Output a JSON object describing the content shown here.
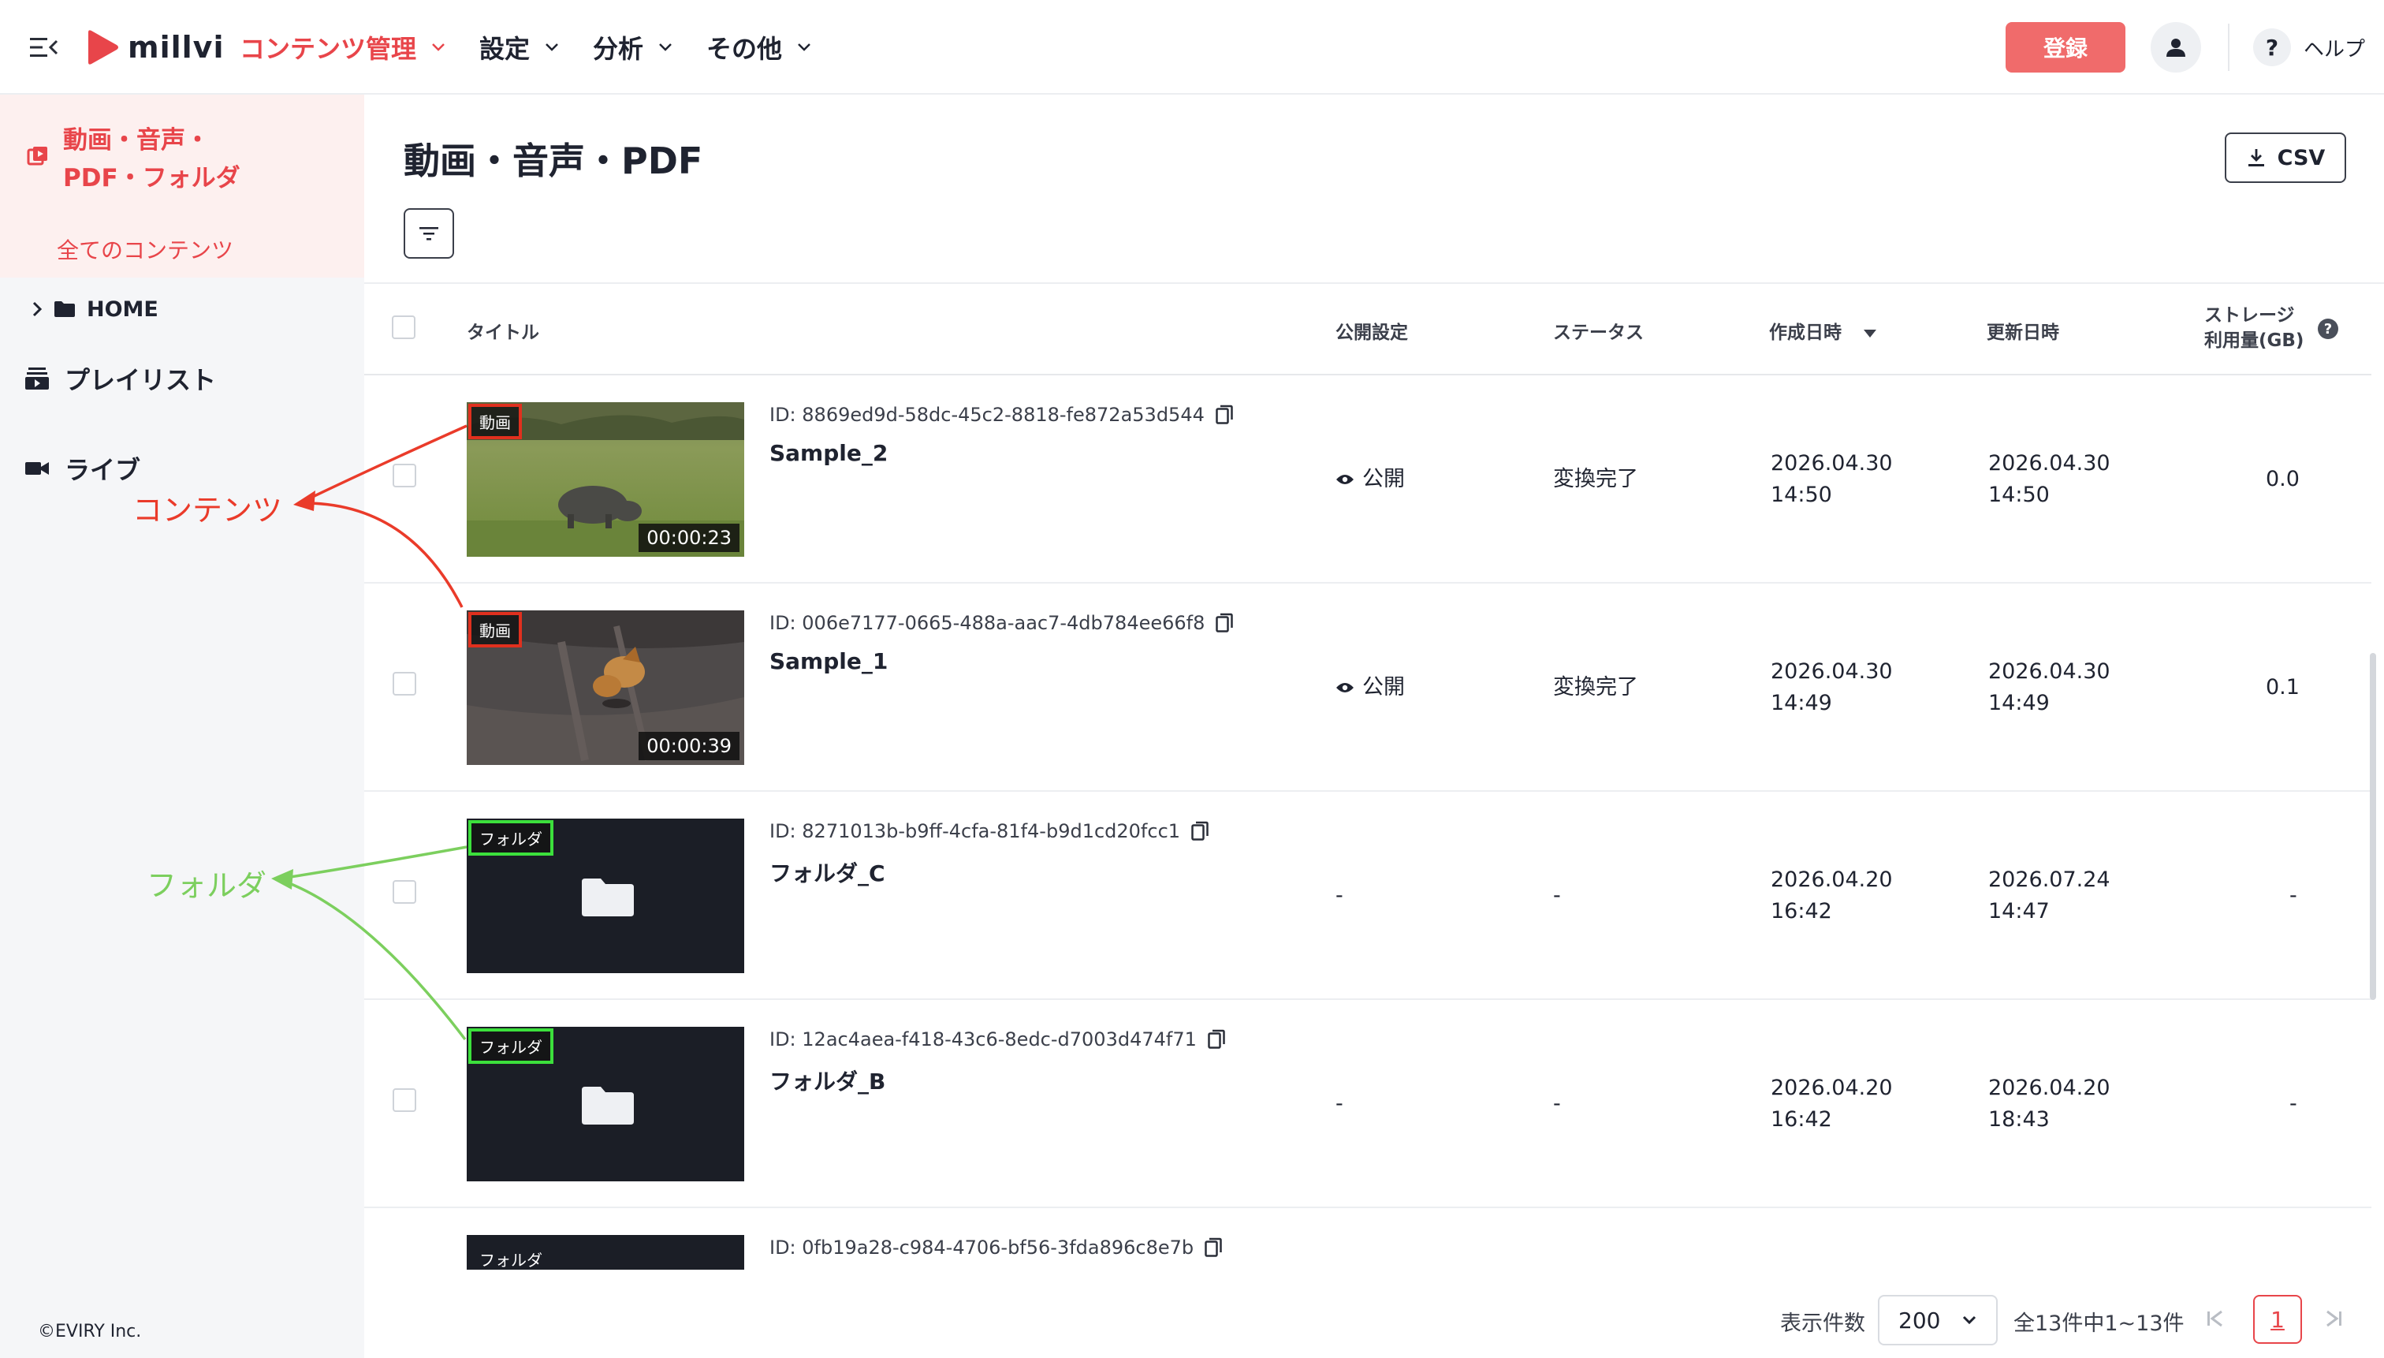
{
  "header": {
    "logo_text": "millvi",
    "nav": [
      {
        "label": "コンテンツ管理",
        "active": true
      },
      {
        "label": "設定"
      },
      {
        "label": "分析"
      },
      {
        "label": "その他"
      }
    ],
    "register_label": "登録",
    "help_glyph": "?",
    "help_label": "ヘルプ"
  },
  "sidebar": {
    "active_title_line1": "動画・音声・",
    "active_title_line2": "PDF・フォルダ",
    "sub_item": "全てのコンテンツ",
    "home": "HOME",
    "playlist": "プレイリスト",
    "live": "ライブ",
    "copyright": "©EVIRY Inc."
  },
  "annotations": {
    "contents": "コンテンツ",
    "folder": "フォルダ"
  },
  "main": {
    "title": "動画・音声・PDF",
    "csv_label": "CSV"
  },
  "table": {
    "headers": {
      "title": "タイトル",
      "visibility": "公開設定",
      "status": "ステータス",
      "created": "作成日時",
      "updated": "更新日時",
      "storage_line1": "ストレージ",
      "storage_line2": "利用量(GB)",
      "storage_info": "?"
    },
    "rows": [
      {
        "type_badge": "動画",
        "duration": "00:00:23",
        "id": "ID: 8869ed9d-58dc-45c2-8818-fe872a53d544",
        "title": "Sample_2",
        "visibility": "公開",
        "status": "変換完了",
        "created_date": "2026.04.30",
        "created_time": "14:50",
        "updated_date": "2026.04.30",
        "updated_time": "14:50",
        "storage": "0.0"
      },
      {
        "type_badge": "動画",
        "duration": "00:00:39",
        "id": "ID: 006e7177-0665-488a-aac7-4db784ee66f8",
        "title": "Sample_1",
        "visibility": "公開",
        "status": "変換完了",
        "created_date": "2026.04.30",
        "created_time": "14:49",
        "updated_date": "2026.04.30",
        "updated_time": "14:49",
        "storage": "0.1"
      },
      {
        "type_badge": "フォルダ",
        "id": "ID: 8271013b-b9ff-4cfa-81f4-b9d1cd20fcc1",
        "title": "フォルダ_C",
        "visibility": "-",
        "status": "-",
        "created_date": "2026.04.20",
        "created_time": "16:42",
        "updated_date": "2026.07.24",
        "updated_time": "14:47",
        "storage": "-"
      },
      {
        "type_badge": "フォルダ",
        "id": "ID: 12ac4aea-f418-43c6-8edc-d7003d474f71",
        "title": "フォルダ_B",
        "visibility": "-",
        "status": "-",
        "created_date": "2026.04.20",
        "created_time": "16:42",
        "updated_date": "2026.04.20",
        "updated_time": "18:43",
        "storage": "-"
      },
      {
        "type_badge": "フォルダ",
        "id": "ID: 0fb19a28-c984-4706-bf56-3fda896c8e7b"
      }
    ]
  },
  "pagination": {
    "per_page_label": "表示件数",
    "per_page_value": "200",
    "count_text": "全13件中1~13件",
    "current_page": "1"
  },
  "colors": {
    "brand": "#e8454a",
    "register_button": "#f06b6b",
    "annotation_red": "#ea3b2a",
    "annotation_green": "#7ccf5e"
  }
}
